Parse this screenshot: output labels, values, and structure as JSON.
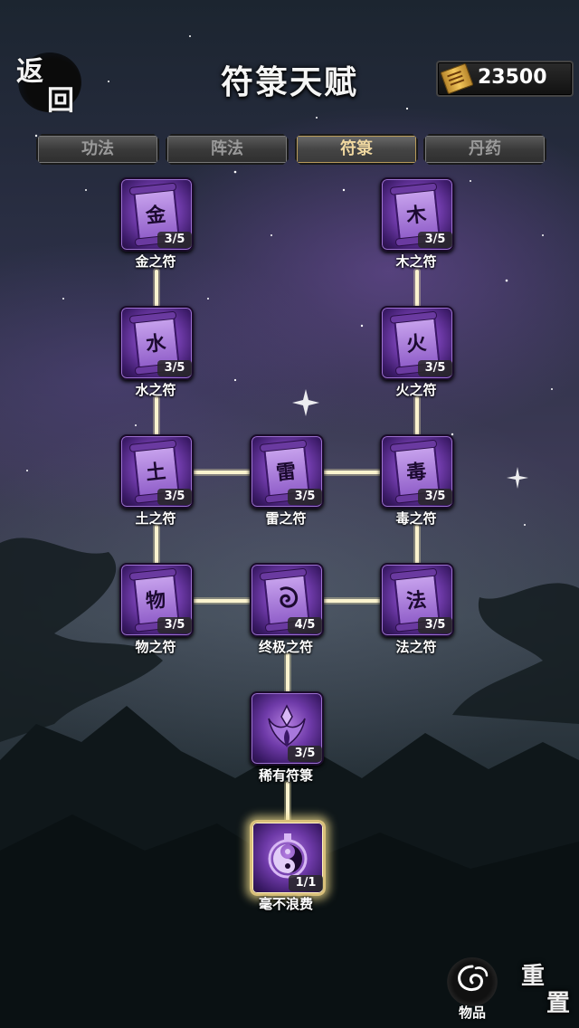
{
  "header": {
    "back": [
      "返",
      "回"
    ],
    "title": "符箓天赋",
    "currency": {
      "icon": "ticket-icon",
      "amount": "23500"
    }
  },
  "tabs": [
    {
      "label": "功法",
      "active": false
    },
    {
      "label": "阵法",
      "active": false
    },
    {
      "label": "符箓",
      "active": true
    },
    {
      "label": "丹药",
      "active": false
    }
  ],
  "talents": {
    "metal": {
      "glyph": "金",
      "level": "3/5",
      "label": "金之符"
    },
    "wood": {
      "glyph": "木",
      "level": "3/5",
      "label": "木之符"
    },
    "water": {
      "glyph": "水",
      "level": "3/5",
      "label": "水之符"
    },
    "fire": {
      "glyph": "火",
      "level": "3/5",
      "label": "火之符"
    },
    "earth": {
      "glyph": "土",
      "level": "3/5",
      "label": "土之符"
    },
    "thunder": {
      "glyph": "雷",
      "level": "3/5",
      "label": "雷之符"
    },
    "poison": {
      "glyph": "毒",
      "level": "3/5",
      "label": "毒之符"
    },
    "physical": {
      "glyph": "物",
      "level": "3/5",
      "label": "物之符"
    },
    "ultimate": {
      "glyph": "",
      "icon": "spiral-icon",
      "level": "4/5",
      "label": "终极之符"
    },
    "magic": {
      "glyph": "法",
      "level": "3/5",
      "label": "法之符"
    },
    "rare": {
      "icon": "flame-crest-icon",
      "level": "3/5",
      "label": "稀有符箓"
    },
    "nowaste": {
      "icon": "yin-yang-icon",
      "level": "1/1",
      "label": "毫不浪费"
    }
  },
  "footer": {
    "items_label": "物品",
    "reset": [
      "重",
      "置"
    ]
  },
  "colors": {
    "node_purple": "#6e3aa8",
    "link_glow": "#f5e9b0",
    "maxed_border": "#d9c07a"
  }
}
